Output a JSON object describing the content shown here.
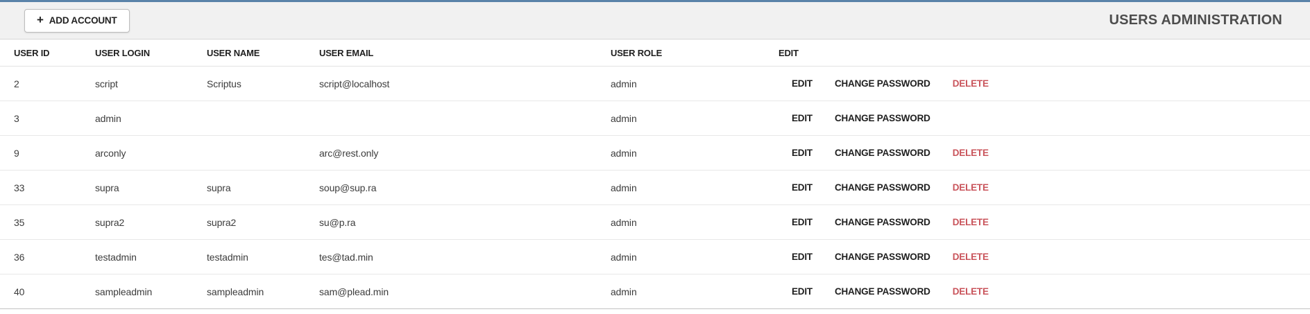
{
  "page": {
    "title": "USERS ADMINISTRATION"
  },
  "toolbar": {
    "add_account_label": "ADD ACCOUNT",
    "plus_icon": "+"
  },
  "colors": {
    "top_accent_line": "#5a83a9",
    "top_bar_background": "#f1f1f1",
    "delete_link": "#c9545b"
  },
  "table": {
    "columns": [
      "USER ID",
      "USER LOGIN",
      "USER NAME",
      "USER EMAIL",
      "USER ROLE",
      "EDIT"
    ],
    "actions": {
      "edit": "EDIT",
      "change_password": "CHANGE PASSWORD",
      "delete": "DELETE"
    },
    "rows": [
      {
        "id": "2",
        "login": "script",
        "name": "Scriptus",
        "email": "script@localhost",
        "role": "admin",
        "can_delete": true
      },
      {
        "id": "3",
        "login": "admin",
        "name": "",
        "email": "",
        "role": "admin",
        "can_delete": false
      },
      {
        "id": "9",
        "login": "arconly",
        "name": "",
        "email": "arc@rest.only",
        "role": "admin",
        "can_delete": true
      },
      {
        "id": "33",
        "login": "supra",
        "name": "supra",
        "email": "soup@sup.ra",
        "role": "admin",
        "can_delete": true
      },
      {
        "id": "35",
        "login": "supra2",
        "name": "supra2",
        "email": "su@p.ra",
        "role": "admin",
        "can_delete": true
      },
      {
        "id": "36",
        "login": "testadmin",
        "name": "testadmin",
        "email": "tes@tad.min",
        "role": "admin",
        "can_delete": true
      },
      {
        "id": "40",
        "login": "sampleadmin",
        "name": "sampleadmin",
        "email": "sam@plead.min",
        "role": "admin",
        "can_delete": true
      }
    ]
  }
}
